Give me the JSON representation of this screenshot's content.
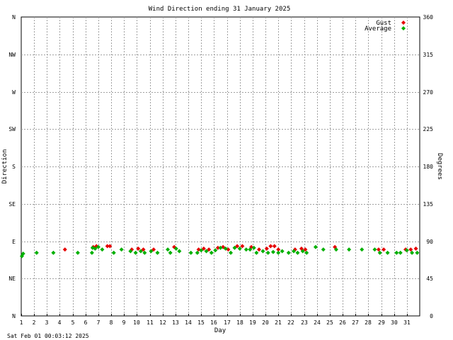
{
  "chart_data": {
    "type": "scatter",
    "title": "Wind Direction ending 31 January 2025",
    "xlabel": "Day",
    "ylabel_left": "Direction",
    "ylabel_right": "Degrees",
    "timestamp": "Sat Feb 01 00:03:12 2025",
    "xlim": [
      1,
      32
    ],
    "ylim": [
      0,
      360
    ],
    "x_ticks": [
      1,
      2,
      3,
      4,
      5,
      6,
      7,
      8,
      9,
      10,
      11,
      12,
      13,
      14,
      15,
      16,
      17,
      18,
      19,
      20,
      21,
      22,
      23,
      24,
      25,
      26,
      27,
      28,
      29,
      30,
      31
    ],
    "y_ticks_degrees": [
      0,
      45,
      90,
      135,
      180,
      225,
      270,
      315,
      360
    ],
    "y_ticks_compass": [
      "N",
      "NE",
      "E",
      "SE",
      "S",
      "SW",
      "W",
      "NW",
      "N"
    ],
    "grid": true,
    "legend_position": "top-right",
    "series": [
      {
        "name": "Gust",
        "color": "#e60000",
        "points": [
          [
            4.4,
            80
          ],
          [
            6.6,
            83
          ],
          [
            6.85,
            84
          ],
          [
            7.7,
            84
          ],
          [
            7.9,
            84
          ],
          [
            9.6,
            80
          ],
          [
            10.1,
            81
          ],
          [
            10.5,
            80
          ],
          [
            11.3,
            80
          ],
          [
            12.9,
            83
          ],
          [
            14.8,
            80
          ],
          [
            15.2,
            81
          ],
          [
            15.6,
            80
          ],
          [
            16.3,
            82
          ],
          [
            16.7,
            83
          ],
          [
            17.1,
            80
          ],
          [
            17.8,
            84
          ],
          [
            18.2,
            84
          ],
          [
            18.9,
            83
          ],
          [
            19.5,
            80
          ],
          [
            20.1,
            81
          ],
          [
            20.4,
            84
          ],
          [
            20.7,
            84
          ],
          [
            21.0,
            80
          ],
          [
            22.3,
            80
          ],
          [
            22.8,
            81
          ],
          [
            23.1,
            80
          ],
          [
            25.4,
            83
          ],
          [
            28.8,
            80
          ],
          [
            29.2,
            80
          ],
          [
            30.9,
            80
          ],
          [
            31.3,
            80
          ],
          [
            31.7,
            81
          ]
        ]
      },
      {
        "name": "Average",
        "color": "#00b000",
        "points": [
          [
            1.05,
            72
          ],
          [
            1.15,
            75
          ],
          [
            2.2,
            76
          ],
          [
            3.5,
            76
          ],
          [
            5.4,
            76
          ],
          [
            6.5,
            76
          ],
          [
            6.55,
            82
          ],
          [
            6.75,
            81
          ],
          [
            7.0,
            83
          ],
          [
            7.3,
            80
          ],
          [
            8.2,
            76
          ],
          [
            8.8,
            80
          ],
          [
            9.5,
            78
          ],
          [
            9.9,
            76
          ],
          [
            10.3,
            78
          ],
          [
            10.6,
            76
          ],
          [
            11.1,
            78
          ],
          [
            11.6,
            76
          ],
          [
            12.4,
            80
          ],
          [
            12.6,
            76
          ],
          [
            13.05,
            81
          ],
          [
            13.3,
            78
          ],
          [
            14.2,
            76
          ],
          [
            14.7,
            76
          ],
          [
            15.0,
            79
          ],
          [
            15.4,
            78
          ],
          [
            15.8,
            76
          ],
          [
            16.1,
            79
          ],
          [
            16.5,
            82
          ],
          [
            16.9,
            81
          ],
          [
            17.3,
            76
          ],
          [
            17.6,
            82
          ],
          [
            18.0,
            81
          ],
          [
            18.5,
            80
          ],
          [
            18.8,
            80
          ],
          [
            19.1,
            82
          ],
          [
            19.3,
            76
          ],
          [
            19.8,
            78
          ],
          [
            20.2,
            76
          ],
          [
            20.6,
            77
          ],
          [
            21.0,
            76
          ],
          [
            21.3,
            78
          ],
          [
            21.8,
            76
          ],
          [
            22.2,
            78
          ],
          [
            22.5,
            76
          ],
          [
            22.9,
            78
          ],
          [
            23.2,
            76
          ],
          [
            23.9,
            83
          ],
          [
            24.5,
            80
          ],
          [
            25.5,
            80
          ],
          [
            26.5,
            80
          ],
          [
            27.5,
            80
          ],
          [
            28.5,
            80
          ],
          [
            28.9,
            76
          ],
          [
            29.5,
            76
          ],
          [
            30.2,
            76
          ],
          [
            30.5,
            76
          ],
          [
            31.0,
            79
          ],
          [
            31.4,
            76
          ],
          [
            31.8,
            76
          ]
        ]
      }
    ]
  }
}
